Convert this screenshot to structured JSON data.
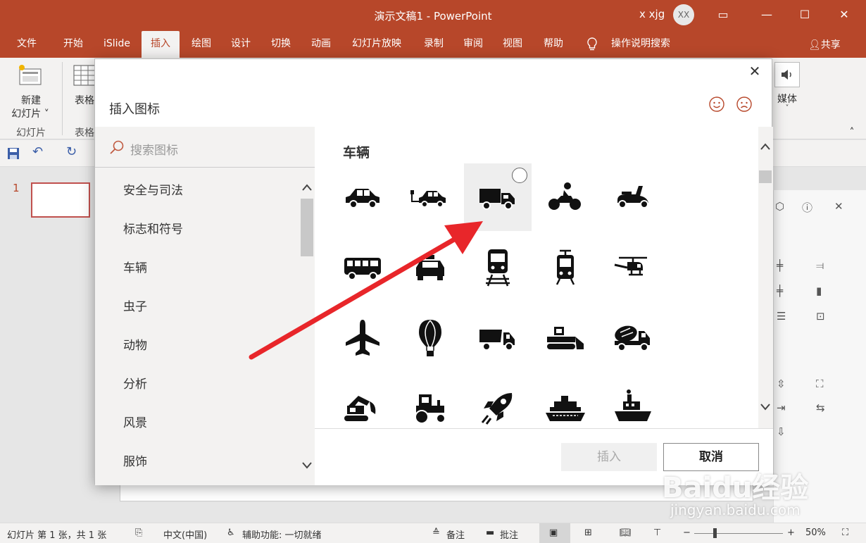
{
  "titlebar": {
    "title": "演示文稿1  -  PowerPoint",
    "user": "x xjg",
    "avatar": "XX"
  },
  "tabs": [
    {
      "label": "文件"
    },
    {
      "label": "开始"
    },
    {
      "label": "iSlide"
    },
    {
      "label": "插入"
    },
    {
      "label": "绘图"
    },
    {
      "label": "设计"
    },
    {
      "label": "切换"
    },
    {
      "label": "动画"
    },
    {
      "label": "幻灯片放映"
    },
    {
      "label": "录制"
    },
    {
      "label": "审阅"
    },
    {
      "label": "视图"
    },
    {
      "label": "帮助"
    }
  ],
  "tell_me": "操作说明搜索",
  "share": "共享",
  "ribbon": {
    "new_slide": "新建",
    "new_slide2": "幻灯片",
    "slides_group": "幻灯片",
    "table": "表格",
    "table_group": "表格",
    "media": "媒体"
  },
  "slide_number": "1",
  "dialog": {
    "title": "插入图标",
    "search_placeholder": "搜索图标",
    "categories": [
      "安全与司法",
      "标志和符号",
      "车辆",
      "虫子",
      "动物",
      "分析",
      "风景",
      "服饰"
    ],
    "section": "车辆",
    "icons": [
      "car-icon",
      "electric-car-icon",
      "truck-icon",
      "motorcycle-icon",
      "scooter-icon",
      "bus-icon",
      "taxi-icon",
      "train-icon",
      "tram-icon",
      "helicopter-icon",
      "airplane-icon",
      "hot-air-balloon-icon",
      "dump-truck-icon",
      "bulldozer-icon",
      "cement-mixer-icon",
      "excavator-icon",
      "tractor-icon",
      "rocket-icon",
      "cruise-ship-icon",
      "boat-icon"
    ],
    "insert_label": "插入",
    "cancel_label": "取消"
  },
  "status": {
    "slide_info": "幻灯片 第 1 张，共 1 张",
    "language": "中文(中国)",
    "accessibility": "辅助功能: 一切就绪",
    "notes": "备注",
    "comments": "批注",
    "zoom": "50%"
  },
  "watermark": {
    "brand": "Baidu经验",
    "url": "jingyan.baidu.com"
  },
  "colors": {
    "accent": "#b7472a",
    "arrow": "#e8262a"
  }
}
